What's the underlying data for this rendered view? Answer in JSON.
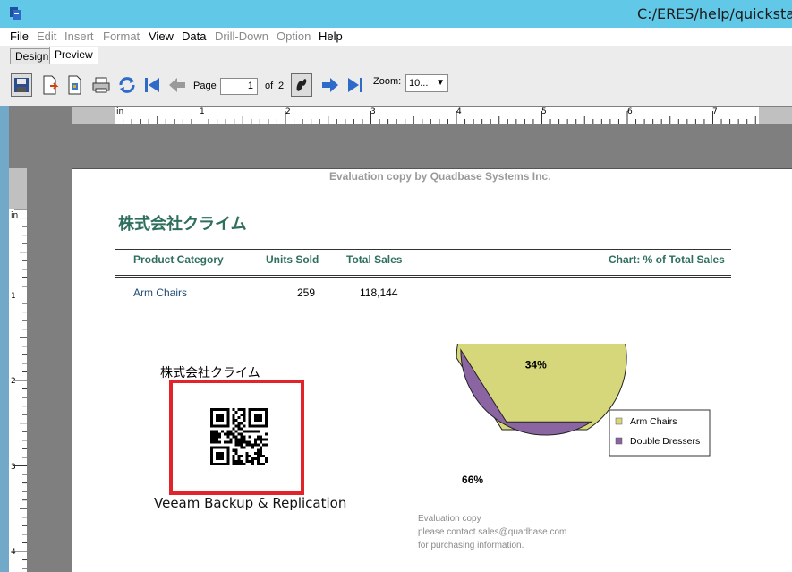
{
  "window": {
    "title": "C:/ERES/help/quickstar"
  },
  "menu": [
    {
      "label": "File",
      "enabled": true
    },
    {
      "label": "Edit",
      "enabled": false
    },
    {
      "label": "Insert",
      "enabled": false
    },
    {
      "label": "Format",
      "enabled": false
    },
    {
      "label": "View",
      "enabled": true
    },
    {
      "label": "Data",
      "enabled": true
    },
    {
      "label": "Drill-Down",
      "enabled": false
    },
    {
      "label": "Option",
      "enabled": false
    },
    {
      "label": "Help",
      "enabled": true
    }
  ],
  "tabs": {
    "design": "Design",
    "preview": "Preview"
  },
  "toolbar": {
    "page_label": "Page",
    "page_value": "1",
    "of_label": "of",
    "page_total": "2",
    "zoom_label": "Zoom:",
    "zoom_value": "10..."
  },
  "ruler": {
    "h_unit": "in",
    "h_marks": [
      "1",
      "2",
      "3",
      "4",
      "5",
      "6",
      "7"
    ],
    "v_unit": "in",
    "v_marks": [
      "1",
      "2",
      "3",
      "4"
    ]
  },
  "report": {
    "watermark": "Evaluation copy by Quadbase Systems Inc.",
    "company": "株式会社クライム",
    "headers": {
      "category": "Product Category",
      "units": "Units Sold",
      "sales": "Total Sales",
      "chart": "Chart: % of Total Sales"
    },
    "rows": [
      {
        "category": "Arm Chairs",
        "units": "259",
        "sales": "118,144"
      }
    ],
    "qr_caption": "株式会社クライム",
    "qr_subtitle": "Veeam Backup & Replication",
    "eval_note": [
      "Evaluation copy",
      "please contact sales@quadbase.com",
      "for purchasing information."
    ]
  },
  "chart_data": {
    "type": "pie",
    "categories": [
      "Arm Chairs",
      "Double Dressers"
    ],
    "values": [
      66,
      34
    ],
    "labels": [
      "66%",
      "34%"
    ],
    "colors": [
      "#d6d67a",
      "#8b64a2"
    ],
    "legend": "right"
  },
  "colors": {
    "titlebar": "#62c8e8",
    "report_heading": "#2e6f5e",
    "highlight_box": "#e3232a"
  }
}
